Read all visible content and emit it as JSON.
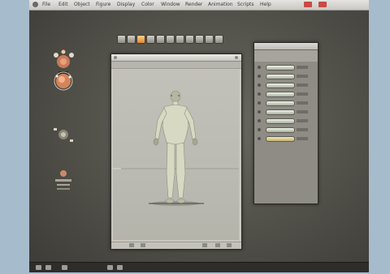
{
  "menubar": {
    "items": [
      "File",
      "Edit",
      "Object",
      "Figure",
      "Display",
      "Color",
      "Window",
      "Render",
      "Animation",
      "Scripts",
      "Help"
    ],
    "clock": ""
  },
  "tools": {
    "label": "",
    "items": [
      "rotate",
      "twist",
      "translate",
      "scale",
      "taper",
      "chain",
      "color",
      "grouping",
      "view-magnifier",
      "morph",
      "direct-manipulation"
    ],
    "active_index": 2
  },
  "left_panel": {
    "light_controls_label": "",
    "camera_controls_label": "",
    "parameter_dials_label": ""
  },
  "viewport": {
    "title": "",
    "camera_label": "",
    "figure": "human-mannequin"
  },
  "properties": {
    "title": "",
    "rows": 9
  },
  "colors": {
    "background": "#a6bccc",
    "desktop": "#54534c",
    "accent": "#e08a2e",
    "viewport": "#c9c7c0"
  }
}
